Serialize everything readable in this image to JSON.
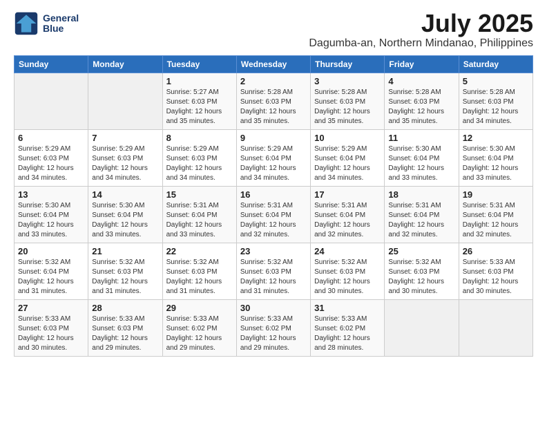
{
  "logo": {
    "line1": "General",
    "line2": "Blue"
  },
  "title": "July 2025",
  "location": "Dagumba-an, Northern Mindanao, Philippines",
  "weekdays": [
    "Sunday",
    "Monday",
    "Tuesday",
    "Wednesday",
    "Thursday",
    "Friday",
    "Saturday"
  ],
  "weeks": [
    [
      {
        "day": "",
        "info": ""
      },
      {
        "day": "",
        "info": ""
      },
      {
        "day": "1",
        "info": "Sunrise: 5:27 AM\nSunset: 6:03 PM\nDaylight: 12 hours and 35 minutes."
      },
      {
        "day": "2",
        "info": "Sunrise: 5:28 AM\nSunset: 6:03 PM\nDaylight: 12 hours and 35 minutes."
      },
      {
        "day": "3",
        "info": "Sunrise: 5:28 AM\nSunset: 6:03 PM\nDaylight: 12 hours and 35 minutes."
      },
      {
        "day": "4",
        "info": "Sunrise: 5:28 AM\nSunset: 6:03 PM\nDaylight: 12 hours and 35 minutes."
      },
      {
        "day": "5",
        "info": "Sunrise: 5:28 AM\nSunset: 6:03 PM\nDaylight: 12 hours and 34 minutes."
      }
    ],
    [
      {
        "day": "6",
        "info": "Sunrise: 5:29 AM\nSunset: 6:03 PM\nDaylight: 12 hours and 34 minutes."
      },
      {
        "day": "7",
        "info": "Sunrise: 5:29 AM\nSunset: 6:03 PM\nDaylight: 12 hours and 34 minutes."
      },
      {
        "day": "8",
        "info": "Sunrise: 5:29 AM\nSunset: 6:03 PM\nDaylight: 12 hours and 34 minutes."
      },
      {
        "day": "9",
        "info": "Sunrise: 5:29 AM\nSunset: 6:04 PM\nDaylight: 12 hours and 34 minutes."
      },
      {
        "day": "10",
        "info": "Sunrise: 5:29 AM\nSunset: 6:04 PM\nDaylight: 12 hours and 34 minutes."
      },
      {
        "day": "11",
        "info": "Sunrise: 5:30 AM\nSunset: 6:04 PM\nDaylight: 12 hours and 33 minutes."
      },
      {
        "day": "12",
        "info": "Sunrise: 5:30 AM\nSunset: 6:04 PM\nDaylight: 12 hours and 33 minutes."
      }
    ],
    [
      {
        "day": "13",
        "info": "Sunrise: 5:30 AM\nSunset: 6:04 PM\nDaylight: 12 hours and 33 minutes."
      },
      {
        "day": "14",
        "info": "Sunrise: 5:30 AM\nSunset: 6:04 PM\nDaylight: 12 hours and 33 minutes."
      },
      {
        "day": "15",
        "info": "Sunrise: 5:31 AM\nSunset: 6:04 PM\nDaylight: 12 hours and 33 minutes."
      },
      {
        "day": "16",
        "info": "Sunrise: 5:31 AM\nSunset: 6:04 PM\nDaylight: 12 hours and 32 minutes."
      },
      {
        "day": "17",
        "info": "Sunrise: 5:31 AM\nSunset: 6:04 PM\nDaylight: 12 hours and 32 minutes."
      },
      {
        "day": "18",
        "info": "Sunrise: 5:31 AM\nSunset: 6:04 PM\nDaylight: 12 hours and 32 minutes."
      },
      {
        "day": "19",
        "info": "Sunrise: 5:31 AM\nSunset: 6:04 PM\nDaylight: 12 hours and 32 minutes."
      }
    ],
    [
      {
        "day": "20",
        "info": "Sunrise: 5:32 AM\nSunset: 6:04 PM\nDaylight: 12 hours and 31 minutes."
      },
      {
        "day": "21",
        "info": "Sunrise: 5:32 AM\nSunset: 6:03 PM\nDaylight: 12 hours and 31 minutes."
      },
      {
        "day": "22",
        "info": "Sunrise: 5:32 AM\nSunset: 6:03 PM\nDaylight: 12 hours and 31 minutes."
      },
      {
        "day": "23",
        "info": "Sunrise: 5:32 AM\nSunset: 6:03 PM\nDaylight: 12 hours and 31 minutes."
      },
      {
        "day": "24",
        "info": "Sunrise: 5:32 AM\nSunset: 6:03 PM\nDaylight: 12 hours and 30 minutes."
      },
      {
        "day": "25",
        "info": "Sunrise: 5:32 AM\nSunset: 6:03 PM\nDaylight: 12 hours and 30 minutes."
      },
      {
        "day": "26",
        "info": "Sunrise: 5:33 AM\nSunset: 6:03 PM\nDaylight: 12 hours and 30 minutes."
      }
    ],
    [
      {
        "day": "27",
        "info": "Sunrise: 5:33 AM\nSunset: 6:03 PM\nDaylight: 12 hours and 30 minutes."
      },
      {
        "day": "28",
        "info": "Sunrise: 5:33 AM\nSunset: 6:03 PM\nDaylight: 12 hours and 29 minutes."
      },
      {
        "day": "29",
        "info": "Sunrise: 5:33 AM\nSunset: 6:02 PM\nDaylight: 12 hours and 29 minutes."
      },
      {
        "day": "30",
        "info": "Sunrise: 5:33 AM\nSunset: 6:02 PM\nDaylight: 12 hours and 29 minutes."
      },
      {
        "day": "31",
        "info": "Sunrise: 5:33 AM\nSunset: 6:02 PM\nDaylight: 12 hours and 28 minutes."
      },
      {
        "day": "",
        "info": ""
      },
      {
        "day": "",
        "info": ""
      }
    ]
  ]
}
